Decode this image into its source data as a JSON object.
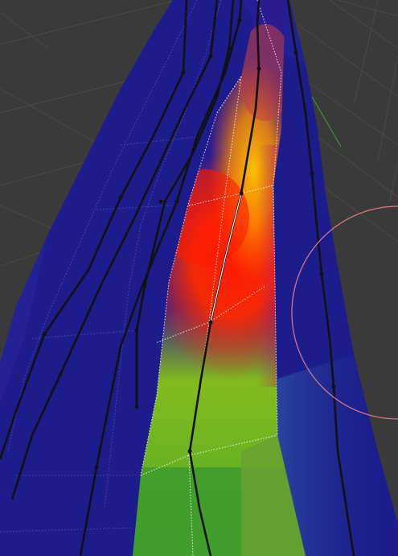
{
  "viewport": {
    "background_color": "#3a3a3a",
    "grid_color": "#4a4a4a",
    "mesh_base_color": "#1c1c8c",
    "heat_colors": [
      "#ff0000",
      "#ffb000",
      "#7fd000",
      "#3a9a2a"
    ],
    "edge_color": "#111111",
    "active_edge_color": "#ffffff",
    "brush_circle_color": "#e07a80",
    "axis_line_color": "#3ca33c"
  },
  "icons": {
    "brush_cursor": "brush-circle-icon",
    "y_axis": "axis-line-icon"
  }
}
